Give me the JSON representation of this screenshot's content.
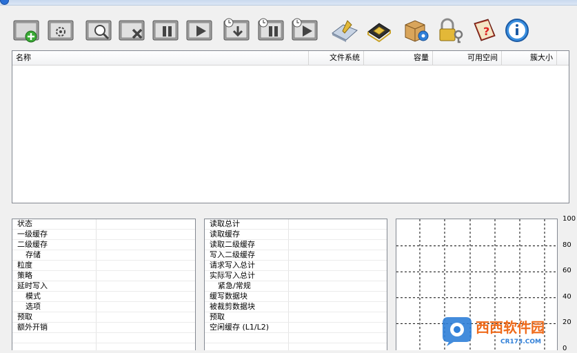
{
  "toolbar": {
    "buttons": [
      {
        "name": "add-volume-button",
        "icon": "folder-add-icon"
      },
      {
        "name": "volume-settings-button",
        "icon": "gear-sheet-icon"
      },
      {
        "name": "search-volume-button",
        "icon": "magnifier-icon"
      },
      {
        "name": "remove-volume-button",
        "icon": "x-mark-icon"
      },
      {
        "name": "pause-volume-button",
        "icon": "pause-icon"
      },
      {
        "name": "resume-volume-button",
        "icon": "play-icon"
      },
      {
        "name": "timed-write-button",
        "icon": "clock-down-icon"
      },
      {
        "name": "timed-pause-button",
        "icon": "clock-pause-icon"
      },
      {
        "name": "timed-resume-button",
        "icon": "clock-play-icon"
      },
      {
        "name": "disk-tools-button",
        "icon": "disk-wrench-icon"
      },
      {
        "name": "memory-chip-button",
        "icon": "chip-icon"
      },
      {
        "name": "package-settings-button",
        "icon": "package-gear-icon"
      },
      {
        "name": "license-lock-button",
        "icon": "lock-key-icon"
      },
      {
        "name": "help-book-button",
        "icon": "book-question-icon"
      },
      {
        "name": "about-info-button",
        "icon": "info-icon"
      }
    ]
  },
  "volumes": {
    "columns": {
      "name": "名称",
      "filesystem": "文件系统",
      "capacity": "容量",
      "free": "可用空间",
      "cluster": "簇大小"
    },
    "rows": []
  },
  "cache_props": [
    {
      "label": "状态",
      "indent": false
    },
    {
      "label": "一级缓存",
      "indent": false
    },
    {
      "label": "二级缓存",
      "indent": false
    },
    {
      "label": "存储",
      "indent": true
    },
    {
      "label": "粒度",
      "indent": false
    },
    {
      "label": "策略",
      "indent": false
    },
    {
      "label": "延时写入",
      "indent": false
    },
    {
      "label": "模式",
      "indent": true
    },
    {
      "label": "选项",
      "indent": true
    },
    {
      "label": "预取",
      "indent": false
    },
    {
      "label": "额外开销",
      "indent": false
    }
  ],
  "stats_props": [
    {
      "label": "读取总计",
      "indent": false
    },
    {
      "label": "读取缓存",
      "indent": false
    },
    {
      "label": "读取二级缓存",
      "indent": false
    },
    {
      "label": "写入二级缓存",
      "indent": false
    },
    {
      "label": "请求写入总计",
      "indent": false
    },
    {
      "label": "实际写入总计",
      "indent": false
    },
    {
      "label": "紧急/常规",
      "indent": true
    },
    {
      "label": "缓写数据块",
      "indent": false
    },
    {
      "label": "被裁剪数据块",
      "indent": false
    },
    {
      "label": "预取",
      "indent": false
    },
    {
      "label": "空闲缓存 (L1/L2)",
      "indent": false
    }
  ],
  "graph": {
    "y_ticks": [
      "100",
      "80",
      "60",
      "40",
      "20",
      "0"
    ]
  },
  "watermark": {
    "brand": "西西软件园",
    "site": "CR173.COM"
  },
  "colors": {
    "accent": "#2a6fd6",
    "grid": "#000000",
    "border": "#828790"
  }
}
